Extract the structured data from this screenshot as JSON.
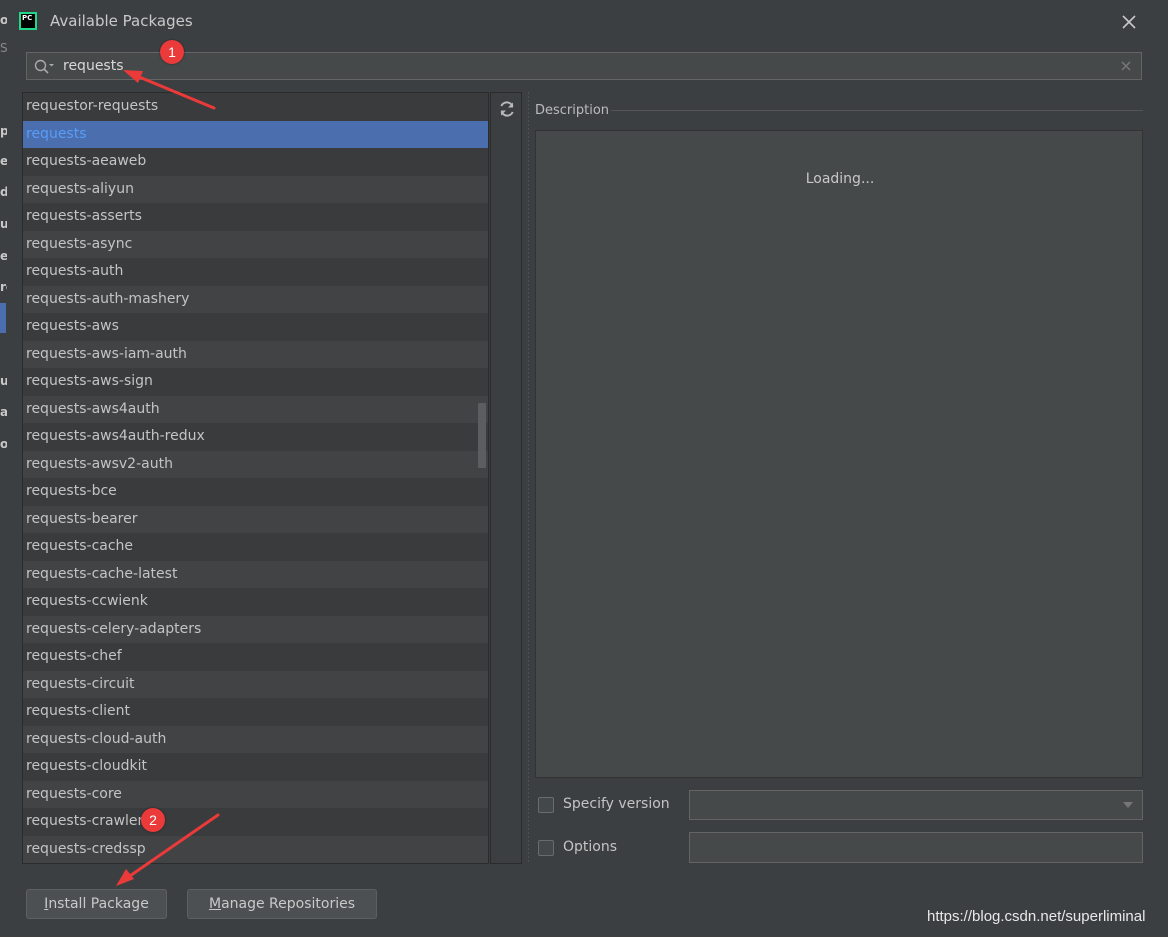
{
  "dialog": {
    "title": "Available Packages",
    "app_icon_text": "PC",
    "close_label": "×"
  },
  "search": {
    "value": "requests",
    "placeholder": ""
  },
  "packages": [
    "requestor-requests",
    "requests",
    "requests-aeaweb",
    "requests-aliyun",
    "requests-asserts",
    "requests-async",
    "requests-auth",
    "requests-auth-mashery",
    "requests-aws",
    "requests-aws-iam-auth",
    "requests-aws-sign",
    "requests-aws4auth",
    "requests-aws4auth-redux",
    "requests-awsv2-auth",
    "requests-bce",
    "requests-bearer",
    "requests-cache",
    "requests-cache-latest",
    "requests-ccwienk",
    "requests-celery-adapters",
    "requests-chef",
    "requests-circuit",
    "requests-client",
    "requests-cloud-auth",
    "requests-cloudkit",
    "requests-core",
    "requests-crawler",
    "requests-credssp"
  ],
  "selected_package": "requests",
  "description": {
    "label": "Description",
    "loading": "Loading..."
  },
  "options": {
    "specify_version_label": "Specify version",
    "options_label": "Options"
  },
  "buttons": {
    "install_first": "I",
    "install_rest": "nstall Package",
    "manage_first": "M",
    "manage_rest": "anage Repositories"
  },
  "annotations": [
    "1",
    "2"
  ],
  "watermark": "https://blog.csdn.net/superliminal",
  "background_ide": {
    "letters": [
      "o",
      "S",
      "p",
      "e",
      "d",
      "u",
      "e",
      "ro",
      "u",
      "ar",
      "o"
    ]
  },
  "colors": {
    "accent_selection": "#4b6eaf",
    "selected_text": "#589df6",
    "annotation_red": "#ea3a3a",
    "pycharm_green": "#21d789"
  }
}
